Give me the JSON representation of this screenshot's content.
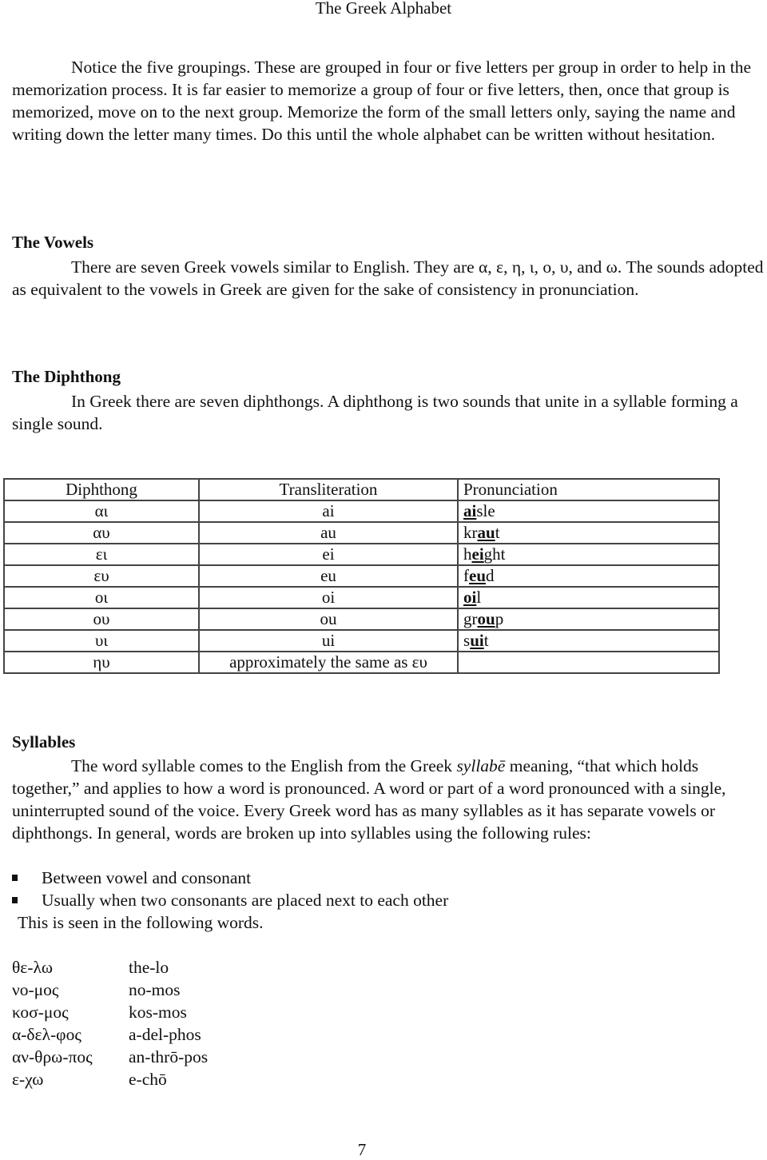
{
  "header": {
    "title": "The Greek Alphabet"
  },
  "intro": {
    "text": "Notice the five groupings. These are grouped in four or five letters per group in order to help in the memorization process. It is far easier to memorize a group of four or five letters, then, once that group is memorized, move on to the next group. Memorize the form of the small letters only, saying the name and writing down the letter many times. Do this until the whole alphabet can be written without hesitation."
  },
  "vowels": {
    "heading": "The Vowels",
    "text": "There are seven Greek vowels similar to English. They are  α, ε, η, ι, ο, υ, and ω. The sounds adopted as equivalent to the vowels in Greek are given for the sake of consistency in pronunciation."
  },
  "diphthong": {
    "heading": "The Diphthong",
    "text": "In Greek there are seven diphthongs. A diphthong is two sounds that unite in a syllable forming a single sound."
  },
  "table": {
    "headers": [
      "Diphthong",
      "Transliteration",
      "Pronunciation"
    ],
    "rows": [
      {
        "diphthong": "αι",
        "translit": "ai",
        "pre": "",
        "hl": "ai",
        "post": "sle"
      },
      {
        "diphthong": "αυ",
        "translit": "au",
        "pre": "kr",
        "hl": "au",
        "post": "t"
      },
      {
        "diphthong": "ει",
        "translit": "ei",
        "pre": "h",
        "hl": "ei",
        "post": "ght"
      },
      {
        "diphthong": "ευ",
        "translit": "eu",
        "pre": "f",
        "hl": "eu",
        "post": "d"
      },
      {
        "diphthong": "οι",
        "translit": "oi",
        "pre": "",
        "hl": "oi",
        "post": "l"
      },
      {
        "diphthong": "ου",
        "translit": "ou",
        "pre": "gr",
        "hl": "ou",
        "post": "p"
      },
      {
        "diphthong": "υι",
        "translit": "ui",
        "pre": "s",
        "hl": "ui",
        "post": "t"
      },
      {
        "diphthong": "ηυ",
        "translit": "approximately the same as ευ",
        "pre": "",
        "hl": "",
        "post": ""
      }
    ]
  },
  "syllables": {
    "heading": "Syllables",
    "text_before_italic": "The word syllable comes to the English from the Greek ",
    "italic_word": "syllabē",
    "text_after_italic": " meaning, “that which holds together,” and applies to how a word is pronounced. A word or part of a word pronounced with a single, uninterrupted sound of the voice. Every Greek word has as many syllables as it has separate vowels or diphthongs. In general, words are broken up into syllables using the following rules:",
    "rules": [
      "Between vowel and consonant",
      "Usually when two consonants are placed next to each other"
    ],
    "followup": "This is seen in the following words."
  },
  "words": [
    {
      "greek": "θε-λω",
      "latin": "the-lo"
    },
    {
      "greek": "νο-μος",
      "latin": "no-mos"
    },
    {
      "greek": "κοσ-μος",
      "latin": "kos-mos"
    },
    {
      "greek": "α-δελ-φος",
      "latin": "a-del-phos"
    },
    {
      "greek": "αν-θρω-πος",
      "latin": "an-thrō-pos"
    },
    {
      "greek": "ε-χω",
      "latin": "e-chō"
    }
  ],
  "page_number": "7"
}
